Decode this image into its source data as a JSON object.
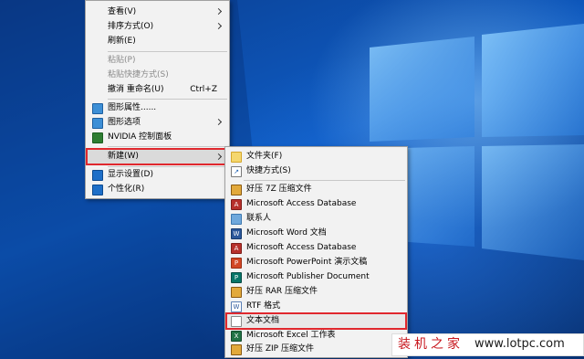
{
  "context_menu": {
    "items": [
      {
        "label": "查看(V)",
        "submenu": true
      },
      {
        "label": "排序方式(O)",
        "submenu": true
      },
      {
        "label": "刷新(E)"
      },
      {
        "label": "粘贴(P)",
        "disabled": true
      },
      {
        "label": "粘贴快捷方式(S)",
        "disabled": true
      },
      {
        "label": "撤消 重命名(U)",
        "shortcut": "Ctrl+Z"
      },
      {
        "label": "图形属性......",
        "icon": "intel-graphics-icon"
      },
      {
        "label": "图形选项",
        "icon": "intel-graphics-icon",
        "submenu": true
      },
      {
        "label": "NVIDIA 控制面板",
        "icon": "nvidia-icon"
      },
      {
        "label": "新建(W)",
        "submenu": true,
        "highlighted": true
      },
      {
        "label": "显示设置(D)",
        "icon": "display-icon"
      },
      {
        "label": "个性化(R)",
        "icon": "personalize-icon"
      }
    ]
  },
  "new_submenu": {
    "items": [
      {
        "label": "文件夹(F)",
        "icon": "folder-icon"
      },
      {
        "label": "快捷方式(S)",
        "icon": "shortcut-icon"
      },
      {
        "label": "好压 7Z 压缩文件",
        "icon": "archive-icon"
      },
      {
        "label": "Microsoft Access Database",
        "icon": "access-icon"
      },
      {
        "label": "联系人",
        "icon": "contact-icon"
      },
      {
        "label": "Microsoft Word 文档",
        "icon": "word-icon"
      },
      {
        "label": "Microsoft Access Database",
        "icon": "access-icon"
      },
      {
        "label": "Microsoft PowerPoint 演示文稿",
        "icon": "powerpoint-icon"
      },
      {
        "label": "Microsoft Publisher Document",
        "icon": "publisher-icon"
      },
      {
        "label": "好压 RAR 压缩文件",
        "icon": "archive-icon"
      },
      {
        "label": "RTF 格式",
        "icon": "rtf-icon"
      },
      {
        "label": "文本文档",
        "icon": "text-document-icon",
        "highlighted": true
      },
      {
        "label": "Microsoft Excel 工作表",
        "icon": "excel-icon"
      },
      {
        "label": "好压 ZIP 压缩文件",
        "icon": "archive-icon"
      }
    ]
  },
  "watermark": {
    "left": "装机之家",
    "right": "www.lotpc.com"
  },
  "colors": {
    "highlight_border": "#e0282e",
    "menu_bg": "#f2f2f2",
    "desktop_blue": "#0e5cc4",
    "watermark_red": "#c8161d"
  }
}
